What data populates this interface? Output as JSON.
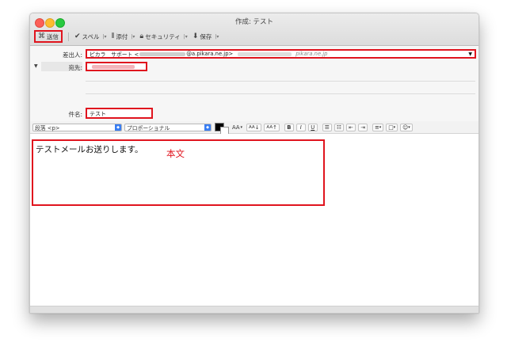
{
  "window": {
    "title": "作成: テスト"
  },
  "toolbar": {
    "send": "送信",
    "spell": "スペル",
    "attach": "添付",
    "security": "セキュリティ",
    "save": "保存"
  },
  "headers": {
    "from_label": "差出人:",
    "from_value": "ピカラ　サポート <",
    "from_domain": "@a.pikara.ne.jp>",
    "from_tail": "pikara.ne.jp",
    "to_label": "宛先:",
    "subject_label": "件名:",
    "subject_value": "テスト"
  },
  "format": {
    "paragraph": "段落 <p>",
    "font": "プロポーショナル",
    "size_down": "AA",
    "size_small": "AA",
    "size_large": "AA",
    "bold": "B",
    "italic": "I",
    "underline": "U",
    "caret": "▾"
  },
  "body": {
    "text": "テストメールお送りします。",
    "annotation": "本文"
  }
}
